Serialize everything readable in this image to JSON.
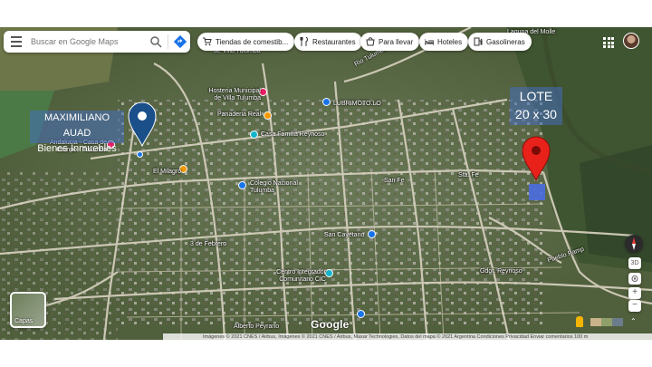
{
  "search": {
    "placeholder": "Buscar en Google Maps"
  },
  "chips": [
    {
      "label": "Tiendas de comestib...",
      "icon": "cart-icon"
    },
    {
      "label": "Restaurantes",
      "icon": "fork-knife-icon"
    },
    {
      "label": "Para llevar",
      "icon": "takeout-icon"
    },
    {
      "label": "Hoteles",
      "icon": "bed-icon"
    },
    {
      "label": "Gasolineras",
      "icon": "fuel-icon"
    }
  ],
  "overlays": {
    "agency_line1": "MAXIMILIANO AUAD",
    "agency_line2": "Bienes Inmuebles",
    "lot_line1": "LOTE",
    "lot_line2": "20 x 30"
  },
  "places": [
    {
      "name": "Hosteria Municipal de Villa Tulumba",
      "color": "#e91e63"
    },
    {
      "name": "LUBRIMOTO.LO",
      "color": "#1a73e8"
    },
    {
      "name": "Panaderia Real",
      "color": "#f29900"
    },
    {
      "name": "Casa Familia Reynoso",
      "color": "#12b5cb"
    },
    {
      "name": "Andalucia - Casa de Campo - Tulumba",
      "color": "#e91e63"
    },
    {
      "name": "El Milagro",
      "color": "#f29900"
    },
    {
      "name": "Colegio Nacional Tulumba",
      "color": "#1a73e8"
    },
    {
      "name": "Centro Integrador Comunitario CIC",
      "color": "#12b5cb"
    }
  ],
  "streets": [
    "de Villa Tulumba",
    "Rio Tulumba",
    "Laguna del Molle",
    "Sta. Fe",
    "San Fe",
    "3 de Febrero",
    "San Cayetano",
    "Gdor. Reynoso",
    "Alberto Peyrano",
    "Pueblo Pamp"
  ],
  "controls": {
    "layers_label": "Capas",
    "view_3d": "3D"
  },
  "brand": "Google",
  "attribution": "Imágenes © 2021 CNES / Airbus, Imágenes © 2021 CNES / Airbus, Maxar Technologies, Datos del mapa © 2021    Argentina    Condiciones    Privacidad    Enviar comentarios    100 m",
  "colors": {
    "pin_agency": "#1a4f8a",
    "pin_lot": "#e8221b",
    "lot_square": "#4a6de0",
    "label_overlay": "rgba(70,110,190,0.55)"
  }
}
